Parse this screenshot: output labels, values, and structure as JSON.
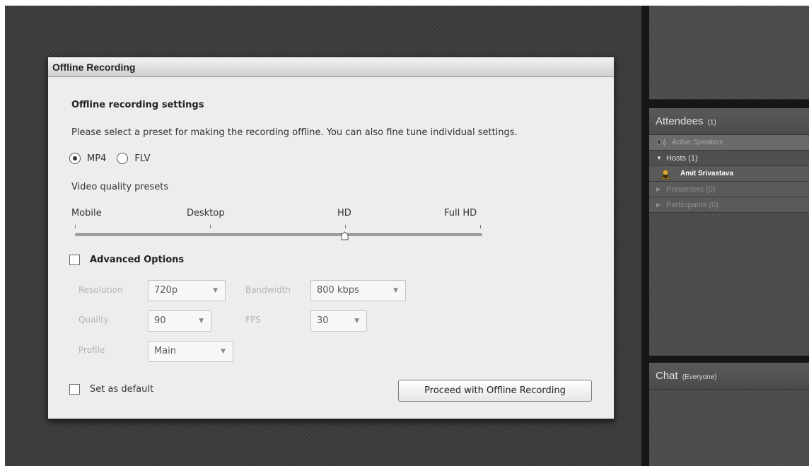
{
  "dialog": {
    "title": "Offline Recording",
    "section_title": "Offline recording settings",
    "instructions": "Please select a preset for making the recording offline. You can also fine tune individual settings.",
    "formats": [
      {
        "label": "MP4",
        "selected": true
      },
      {
        "label": "FLV",
        "selected": false
      }
    ],
    "presets_label": "Video quality presets",
    "presets": [
      "Mobile",
      "Desktop",
      "HD",
      "Full HD"
    ],
    "selected_preset": "HD",
    "advanced_label": "Advanced Options",
    "advanced_checked": false,
    "fields": {
      "resolution_label": "Resolution",
      "resolution_value": "720p",
      "bandwidth_label": "Bandwidth",
      "bandwidth_value": "800 kbps",
      "quality_label": "Quality",
      "quality_value": "90",
      "fps_label": "FPS",
      "fps_value": "30",
      "profile_label": "Profile",
      "profile_value": "Main"
    },
    "default_label": "Set as default",
    "default_checked": false,
    "proceed_label": "Proceed with Offline Recording"
  },
  "attendees": {
    "title": "Attendees",
    "count": "(1)",
    "active_speakers": "Active Speakers",
    "hosts": "Hosts (1)",
    "host_user": "Amit Srivastava",
    "presenters": "Presenters (0)",
    "participants": "Participants (0)"
  },
  "chat": {
    "title": "Chat",
    "scope": "(Everyone)"
  },
  "icons": {
    "radio_selected": "radio-selected-icon",
    "radio_unselected": "radio-unselected-icon",
    "dropdown": "chevron-down-icon",
    "speaker": "phone-speaker-icon",
    "host": "host-user-icon",
    "expand": "triangle-right-icon",
    "collapse": "triangle-down-icon"
  },
  "colors": {
    "dialog_bg": "#ededed",
    "app_bg": "#3a3a3a",
    "panel_bg": "#4a4a4a",
    "disabled_text": "#b4b4b4"
  }
}
